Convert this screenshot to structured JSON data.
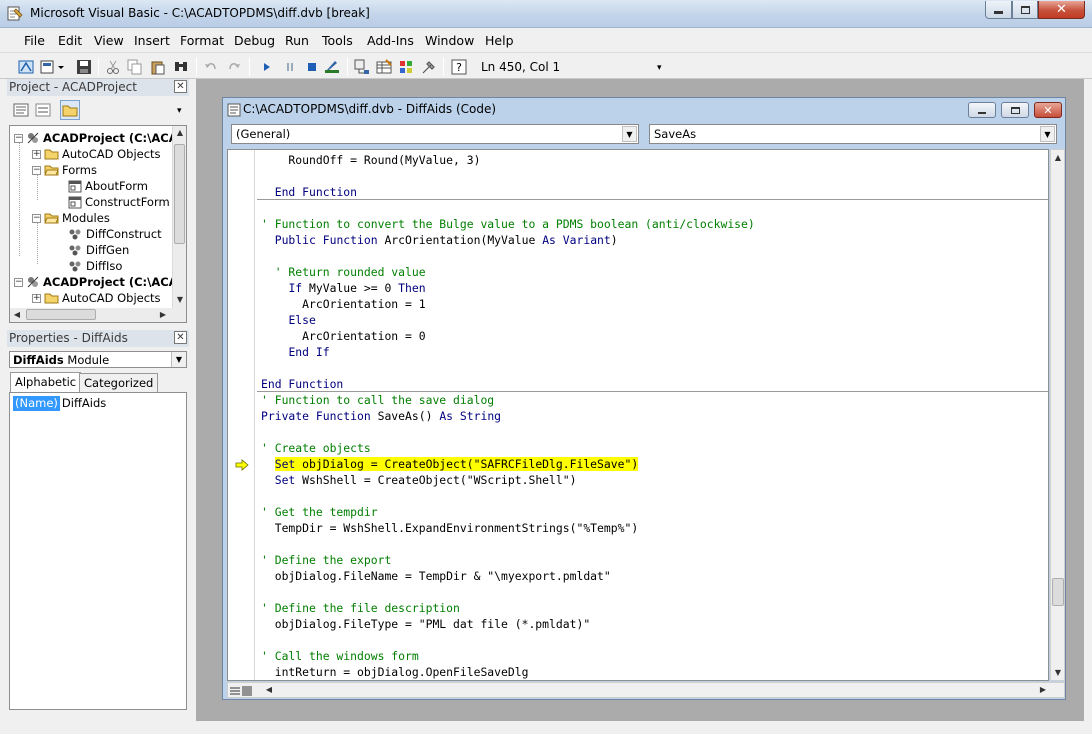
{
  "window": {
    "title": "Microsoft Visual Basic - C:\\ACADTOPDMS\\diff.dvb [break]"
  },
  "menu": [
    "File",
    "Edit",
    "View",
    "Insert",
    "Format",
    "Debug",
    "Run",
    "Tools",
    "Add-Ins",
    "Window",
    "Help"
  ],
  "toolbar": {
    "icons": [
      "view-acad-icon",
      "insert-module-icon",
      "save-icon",
      "cut-icon",
      "copy-icon",
      "paste-icon",
      "find-icon",
      "undo-icon",
      "redo-icon",
      "run-icon",
      "break-icon",
      "reset-icon",
      "design-mode-icon",
      "project-explorer-icon",
      "properties-window-icon",
      "object-browser-icon",
      "toolbox-icon",
      "help-icon"
    ],
    "cursor_position": "Ln 450, Col 1"
  },
  "project": {
    "title": "Project - ACADProject",
    "close_label": "✕",
    "tree": [
      {
        "label": "ACADProject (C:\\ACA",
        "bold": true,
        "icon": "vba-project-icon"
      },
      {
        "label": "AutoCAD Objects",
        "icon": "folder-icon"
      },
      {
        "label": "Forms",
        "icon": "folder-open-icon"
      },
      {
        "label": "AboutForm",
        "icon": "form-icon"
      },
      {
        "label": "ConstructForm",
        "icon": "form-icon"
      },
      {
        "label": "Modules",
        "icon": "folder-open-icon"
      },
      {
        "label": "DiffConstruct",
        "icon": "module-icon"
      },
      {
        "label": "DiffGen",
        "icon": "module-icon"
      },
      {
        "label": "DiffIso",
        "icon": "module-icon"
      },
      {
        "label": "ACADProject (C:\\ACA",
        "bold": true,
        "icon": "vba-project-icon"
      },
      {
        "label": "AutoCAD Objects",
        "icon": "folder-icon"
      }
    ]
  },
  "properties": {
    "title": "Properties - DiffAids",
    "close_label": "✕",
    "object_name": "DiffAids",
    "object_type": "Module",
    "tabs": [
      "Alphabetic",
      "Categorized"
    ],
    "rows": [
      {
        "name": "(Name)",
        "value": "DiffAids"
      }
    ]
  },
  "code_window": {
    "title": "C:\\ACADTOPDMS\\diff.dvb - DiffAids (Code)",
    "object_combo": "(General)",
    "procedure_combo": "SaveAs",
    "lines": [
      "    RoundOff = Round(MyValue, 3)",
      "",
      "  End Function",
      "",
      "' Function to convert the Bulge value to a PDMS boolean (anti/clockwise)",
      "  Public Function ArcOrientation(MyValue As Variant)",
      "",
      "  ' Return rounded value",
      "    If MyValue >= 0 Then",
      "      ArcOrientation = 1",
      "    Else",
      "      ArcOrientation = 0",
      "    End If",
      "",
      "End Function",
      "' Function to call the save dialog",
      "Private Function SaveAs() As String",
      "",
      "' Create objects",
      "  Set objDialog = CreateObject(\"SAFRCFileDlg.FileSave\")",
      "  Set WshShell = CreateObject(\"WScript.Shell\")",
      "",
      "' Get the tempdir",
      "  TempDir = WshShell.ExpandEnvironmentStrings(\"%Temp%\")",
      "",
      "' Define the export",
      "  objDialog.FileName = TempDir & \"\\myexport.pmldat\"",
      "",
      "' Define the file description",
      "  objDialog.FileType = \"PML dat file (*.pmldat)\"",
      "",
      "' Call the windows form",
      "  intReturn = objDialog.OpenFileSaveDlg"
    ],
    "current_line_index": 19
  }
}
